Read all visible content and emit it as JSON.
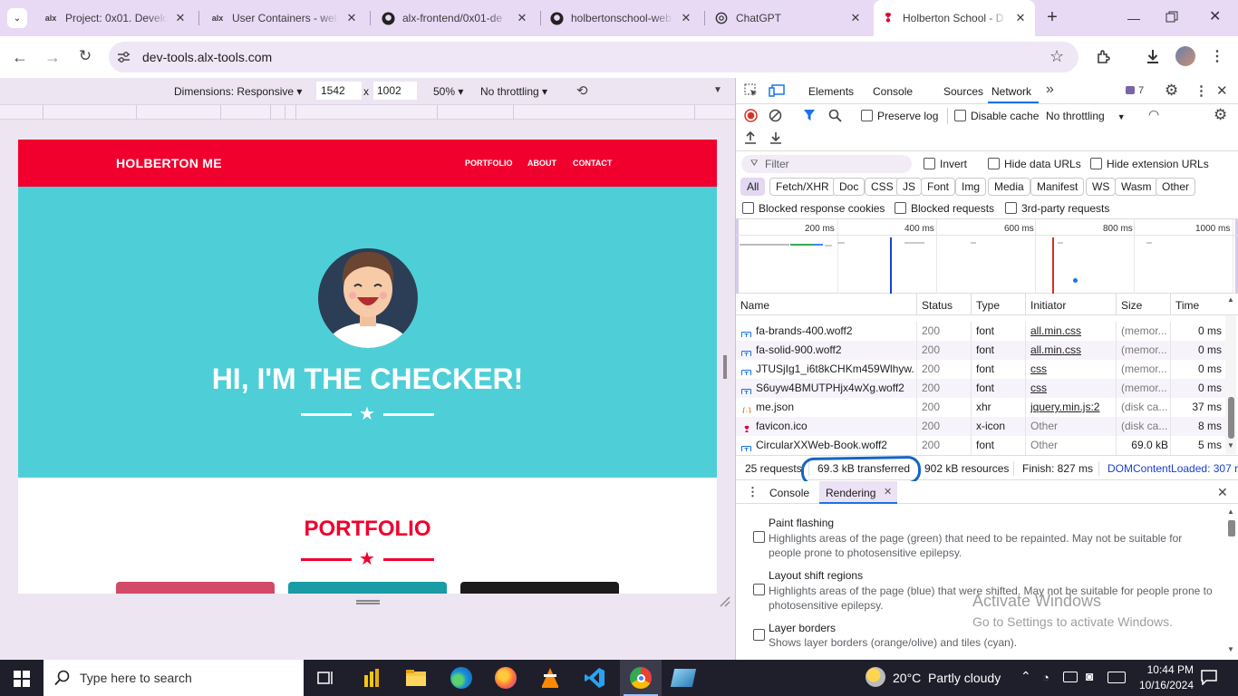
{
  "tabs": [
    {
      "title": "Project: 0x01. Develop",
      "favicon": "alx"
    },
    {
      "title": "User Containers - wel",
      "favicon": "alx"
    },
    {
      "title": "alx-frontend/0x01-de",
      "favicon": "github-icon"
    },
    {
      "title": "holbertonschool-web",
      "favicon": "github-icon"
    },
    {
      "title": "ChatGPT",
      "favicon": "chatgpt-icon"
    },
    {
      "title": "Holberton School - D",
      "favicon": "holberton-icon"
    }
  ],
  "address": {
    "url": "dev-tools.alx-tools.com"
  },
  "device_toolbar": {
    "dimensions_label": "Dimensions: Responsive",
    "width": "1542",
    "x_sep": "x",
    "height": "1002",
    "zoom": "50%",
    "throttling": "No throttling"
  },
  "site": {
    "brand": "HOLBERTON ME",
    "nav": [
      "PORTFOLIO",
      "ABOUT",
      "CONTACT"
    ],
    "hero_title": "HI, I'M THE CHECKER!",
    "portfolio_title": "PORTFOLIO",
    "colors": {
      "red": "#f1002e",
      "teal": "#4ecfd7"
    }
  },
  "devtools": {
    "panel_tabs": [
      "Elements",
      "Console",
      "Sources",
      "Network"
    ],
    "active_tab": "Network",
    "issues_count": "7",
    "net_toolbar": {
      "preserve_log": "Preserve log",
      "disable_cache": "Disable cache",
      "throttling": "No throttling"
    },
    "filter": {
      "placeholder": "Filter",
      "invert": "Invert",
      "hide_data_urls": "Hide data URLs",
      "hide_ext_urls": "Hide extension URLs"
    },
    "type_chips": [
      "All",
      "Fetch/XHR",
      "Doc",
      "CSS",
      "JS",
      "Font",
      "Img",
      "Media",
      "Manifest",
      "WS",
      "Wasm",
      "Other"
    ],
    "blocked": {
      "cookies": "Blocked response cookies",
      "requests": "Blocked requests",
      "third_party": "3rd-party requests"
    },
    "timeline_ticks": [
      "200 ms",
      "400 ms",
      "600 ms",
      "800 ms",
      "1000 ms"
    ],
    "columns": [
      "Name",
      "Status",
      "Type",
      "Initiator",
      "Size",
      "Time"
    ],
    "rows": [
      {
        "name": "fa-brands-400.woff2",
        "status": "200",
        "type": "font",
        "initiator": "all.min.css",
        "size": "(memor...",
        "time": "0 ms",
        "icon": "doc"
      },
      {
        "name": "fa-solid-900.woff2",
        "status": "200",
        "type": "font",
        "initiator": "all.min.css",
        "size": "(memor...",
        "time": "0 ms",
        "icon": "doc"
      },
      {
        "name": "JTUSjIg1_i6t8kCHKm459Wlhyw...",
        "status": "200",
        "type": "font",
        "initiator": "css",
        "size": "(memor...",
        "time": "0 ms",
        "icon": "doc"
      },
      {
        "name": "S6uyw4BMUTPHjx4wXg.woff2",
        "status": "200",
        "type": "font",
        "initiator": "css",
        "size": "(memor...",
        "time": "0 ms",
        "icon": "doc"
      },
      {
        "name": "me.json",
        "status": "200",
        "type": "xhr",
        "initiator": "jquery.min.js:2",
        "size": "(disk ca...",
        "time": "37 ms",
        "icon": "json"
      },
      {
        "name": "favicon.ico",
        "status": "200",
        "type": "x-icon",
        "initiator": "Other",
        "size": "(disk ca...",
        "time": "8 ms",
        "icon": "favicon"
      },
      {
        "name": "CircularXXWeb-Book.woff2",
        "status": "200",
        "type": "font",
        "initiator": "Other",
        "size": "69.0 kB",
        "time": "5 ms",
        "icon": "doc"
      }
    ],
    "summary": {
      "requests": "25 requests",
      "transferred": "69.3 kB transferred",
      "resources": "902 kB resources",
      "finish": "Finish: 827 ms",
      "dcl": "DOMContentLoaded: 307 r"
    },
    "drawer_tabs": [
      "Console",
      "Rendering"
    ],
    "rendering": [
      {
        "title": "Paint flashing",
        "desc": "Highlights areas of the page (green) that need to be repainted. May not be suitable for people prone to photosensitive epilepsy."
      },
      {
        "title": "Layout shift regions",
        "desc": "Highlights areas of the page (blue) that were shifted. May not be suitable for people prone to photosensitive epilepsy."
      },
      {
        "title": "Layer borders",
        "desc": "Shows layer borders (orange/olive) and tiles (cyan)."
      }
    ],
    "watermark": {
      "line1": "Activate Windows",
      "line2": "Go to Settings to activate Windows."
    }
  },
  "taskbar": {
    "search_placeholder": "Type here to search",
    "weather": "20°C  Partly cloudy",
    "time": "10:44 PM",
    "date": "10/16/2024"
  }
}
